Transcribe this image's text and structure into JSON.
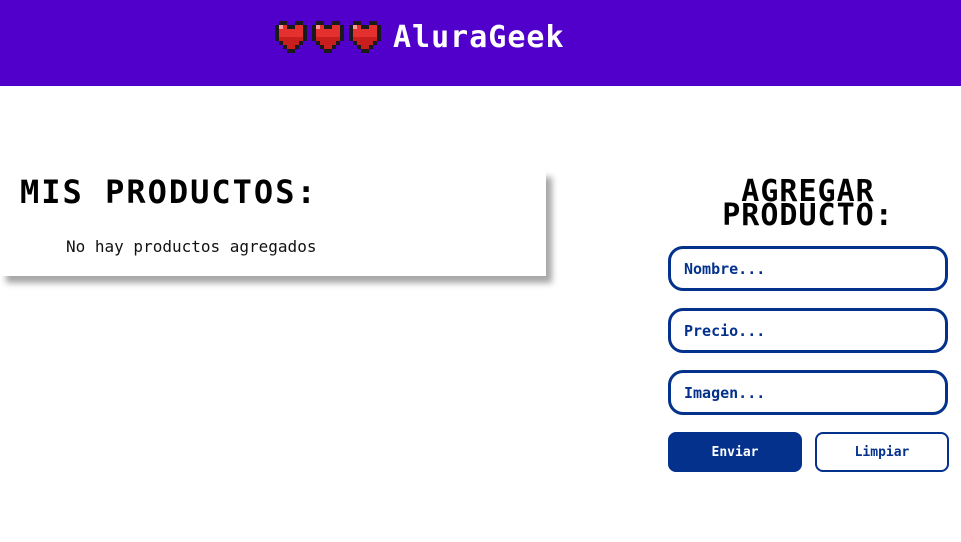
{
  "header": {
    "brand_name": "AluraGeek",
    "heart_icons": [
      "heart-icon",
      "heart-icon",
      "heart-icon"
    ],
    "bg_color": "#5000ca"
  },
  "products": {
    "title": "MIS PRODUCTOS:",
    "empty_message": "No hay productos agregados"
  },
  "form": {
    "title_line1": "AGREGAR",
    "title_line2": "PRODUCTO:",
    "name_placeholder": "Nombre...",
    "price_placeholder": "Precio...",
    "image_placeholder": "Imagen...",
    "send_label": "Enviar",
    "clear_label": "Limpiar",
    "accent_color": "#03318c"
  }
}
